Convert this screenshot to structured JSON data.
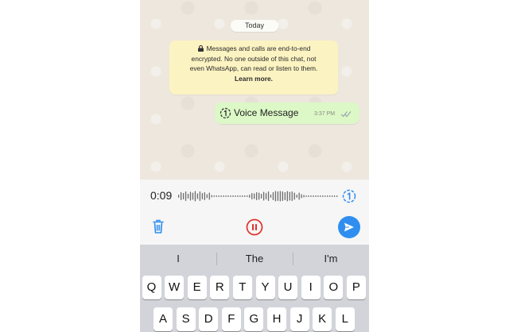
{
  "chat": {
    "date_label": "Today",
    "encryption_notice": {
      "line1": "Messages and calls are end-to-end",
      "line2": "encrypted. No one outside of this chat, not",
      "line3": "even WhatsApp, can read or listen to them.",
      "link": "Learn more."
    },
    "message": {
      "label": "Voice Message",
      "time": "3:37 PM",
      "icon": "view-once-icon",
      "status": "delivered-double-tick"
    }
  },
  "recorder": {
    "timer": "0:09",
    "view_once_icon": "view-once-icon",
    "actions": [
      "trash-icon",
      "pause-icon",
      "send-icon"
    ]
  },
  "keyboard": {
    "suggestions": [
      "I",
      "The",
      "I'm"
    ],
    "row1": [
      "Q",
      "W",
      "E",
      "R",
      "T",
      "Y",
      "U",
      "I",
      "O",
      "P"
    ],
    "row2": [
      "A",
      "S",
      "D",
      "F",
      "G",
      "H",
      "J",
      "K",
      "L"
    ]
  },
  "colors": {
    "chat_bg": "#ede7de",
    "notice_bg": "#fcf3c2",
    "outgoing_bubble": "#dcf8c6",
    "accent_blue": "#2f8ef0",
    "pause_red": "#e0322c",
    "keyboard_bg": "#d2d4da"
  }
}
